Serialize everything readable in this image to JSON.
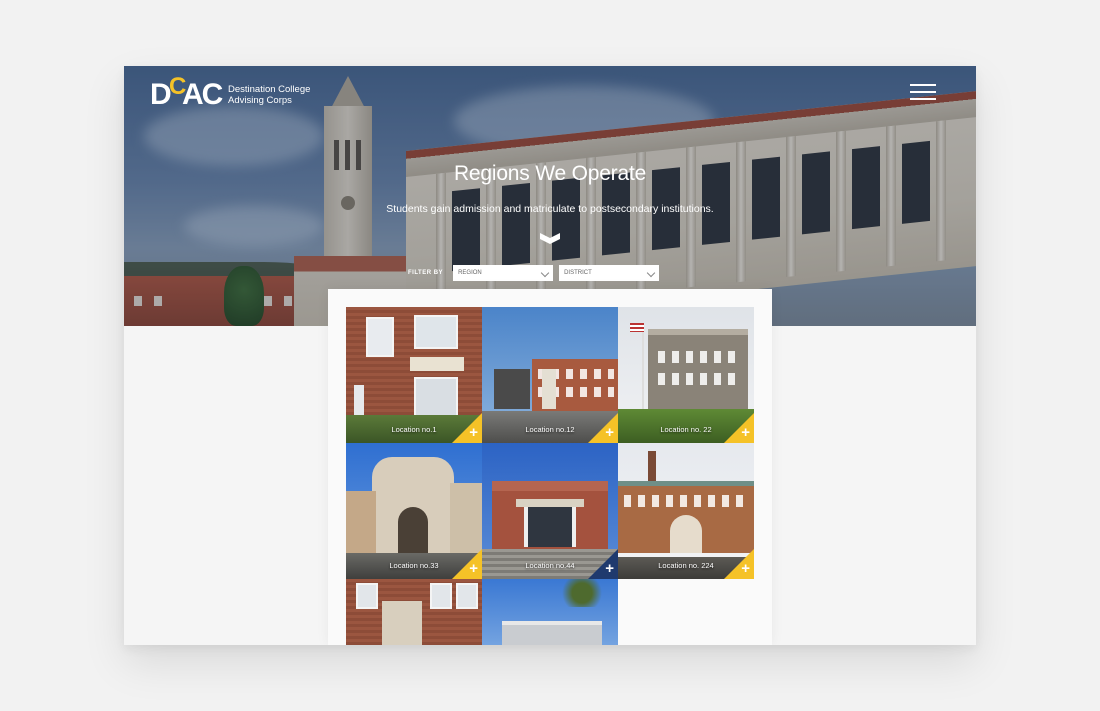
{
  "brand": {
    "mark": "DCAC",
    "name_line1": "Destination College",
    "name_line2": "Advising Corps",
    "accent_color": "#f5c227",
    "navy_color": "#1f3a6e"
  },
  "header": {
    "menu_icon": "hamburger-icon"
  },
  "hero": {
    "title": "Regions We Operate",
    "subtitle": "Students gain admission and matriculate to postsecondary institutions.",
    "scroll_icon": "chevron-down-icon"
  },
  "filter": {
    "label": "FILTER BY",
    "region": {
      "value": "REGION"
    },
    "district": {
      "value": "DISTRICT"
    }
  },
  "locations": [
    {
      "label": "Location no.1",
      "icon": "plus-icon"
    },
    {
      "label": "Location no.12",
      "icon": "plus-icon"
    },
    {
      "label": "Location no. 22",
      "icon": "plus-icon"
    },
    {
      "label": "Location no.33",
      "icon": "plus-icon"
    },
    {
      "label": "Location no.44",
      "icon": "plus-icon",
      "active": true
    },
    {
      "label": "Location no. 224",
      "icon": "plus-icon"
    },
    {
      "label": "",
      "icon": ""
    },
    {
      "label": "",
      "icon": ""
    }
  ]
}
